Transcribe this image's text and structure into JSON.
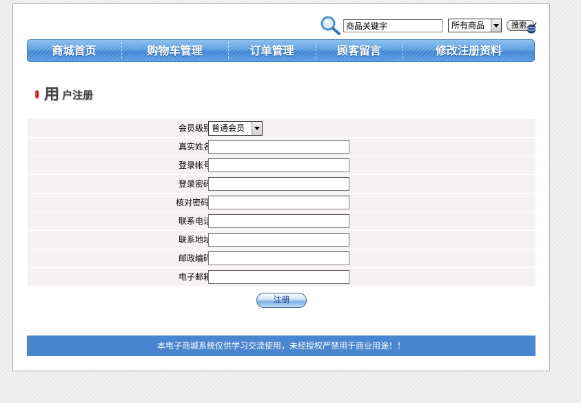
{
  "search": {
    "input_value": "商品关键字",
    "category_selected": "所有商品",
    "button_label": "搜索"
  },
  "nav": {
    "items": [
      {
        "label": "商城首页"
      },
      {
        "label": "购物车管理"
      },
      {
        "label": "订单管理"
      },
      {
        "label": "顾客留言"
      },
      {
        "label": "修改注册资料"
      }
    ]
  },
  "heading": {
    "first_char": "用",
    "rest": "户注册"
  },
  "form": {
    "fields": [
      {
        "label": "会员级别：",
        "type": "select",
        "value": "普通会员"
      },
      {
        "label": "真实姓名：",
        "type": "text",
        "value": ""
      },
      {
        "label": "登录帐号：",
        "type": "text",
        "value": ""
      },
      {
        "label": "登录密码：",
        "type": "text",
        "value": ""
      },
      {
        "label": "核对密码 ：",
        "type": "text",
        "value": ""
      },
      {
        "label": "联系电话：",
        "type": "text",
        "value": ""
      },
      {
        "label": "联系地址：",
        "type": "text",
        "value": ""
      },
      {
        "label": "邮政编码：",
        "type": "text",
        "value": ""
      },
      {
        "label": "电子邮箱：",
        "type": "text",
        "value": ""
      }
    ],
    "submit_label": "注册"
  },
  "footer": {
    "text": "本电子商城系统仅供学习交流使用，未经授权严禁用于商业用途！！"
  },
  "colors": {
    "nav_blue": "#4a86cf",
    "footer_blue": "#4a86cf",
    "form_row_bg": "#f6f2f4",
    "heading_marker": "#c00000"
  }
}
